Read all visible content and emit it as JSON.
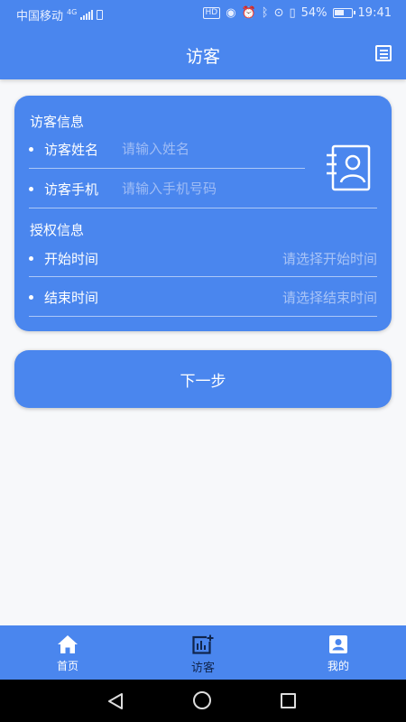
{
  "status_bar": {
    "carrier": "中国移动",
    "network": "4G",
    "hd_badge": "HD",
    "battery_percent": "54%",
    "time": "19:41"
  },
  "header": {
    "title": "访客"
  },
  "visitor_section": {
    "title": "访客信息",
    "name_label": "访客姓名",
    "name_placeholder": "请输入姓名",
    "phone_label": "访客手机",
    "phone_placeholder": "请输入手机号码"
  },
  "auth_section": {
    "title": "授权信息",
    "start_label": "开始时间",
    "start_placeholder": "请选择开始时间",
    "end_label": "结束时间",
    "end_placeholder": "请选择结束时间"
  },
  "next_button": {
    "label": "下一步"
  },
  "tabbar": {
    "items": [
      {
        "label": "首页",
        "icon": "home-icon",
        "active": false
      },
      {
        "label": "访客",
        "icon": "visitor-add-icon",
        "active": true
      },
      {
        "label": "我的",
        "icon": "profile-icon",
        "active": false
      }
    ]
  },
  "colors": {
    "primary": "#4a86ee",
    "background": "#f7f8fa",
    "active_tab_text": "#10254d",
    "placeholder": "#9fbcf5"
  }
}
